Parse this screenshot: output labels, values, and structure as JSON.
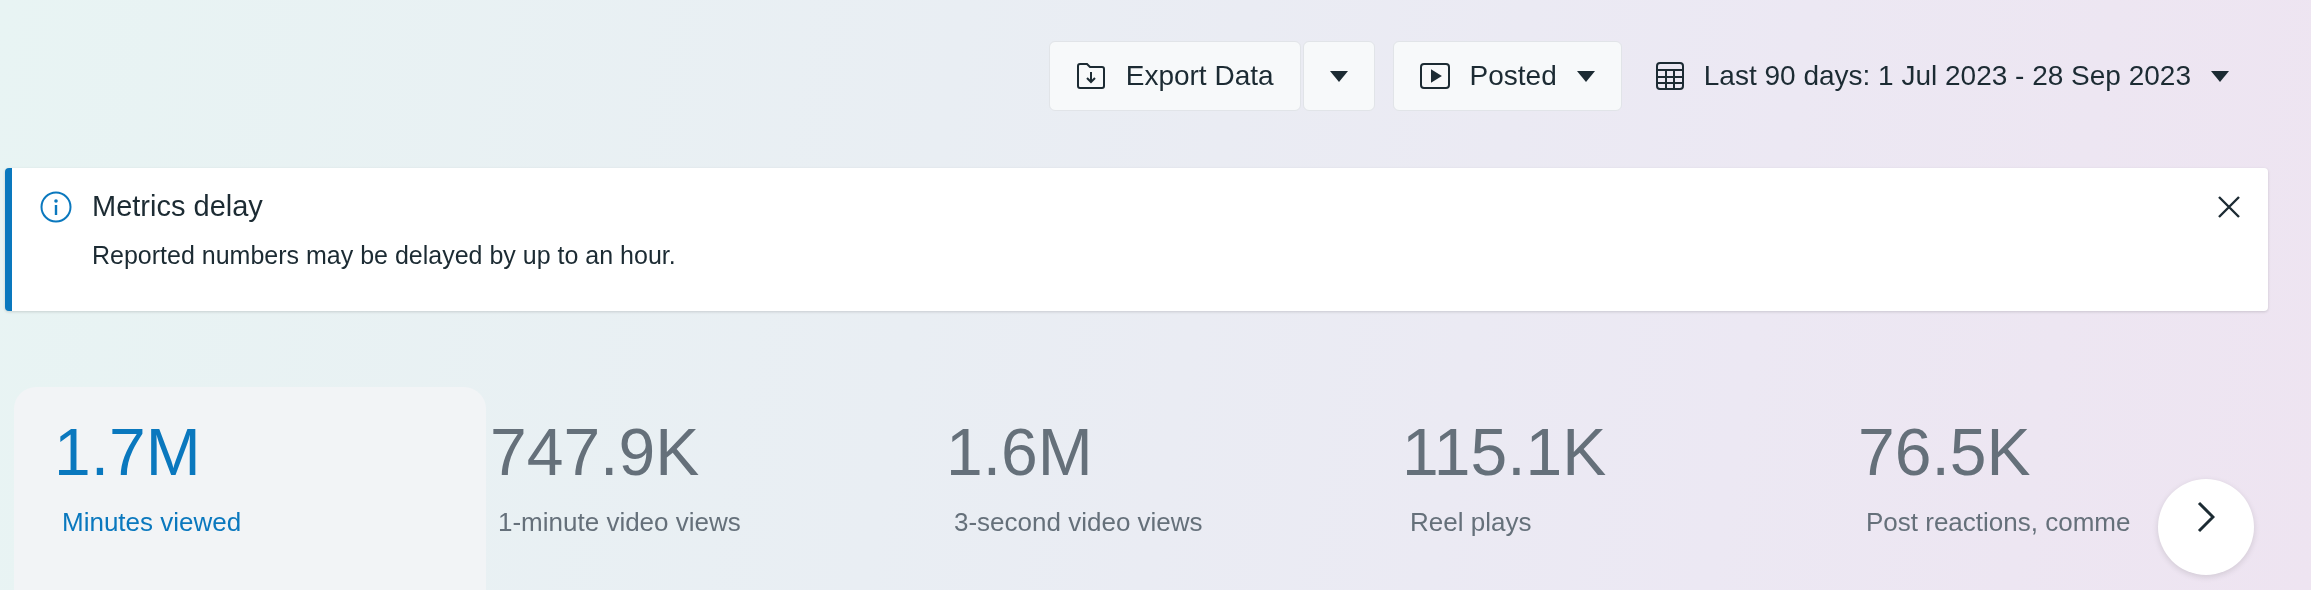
{
  "toolbar": {
    "export_button": {
      "label": "Export Data"
    },
    "status_filter": {
      "label": "Posted"
    },
    "date_range": {
      "label": "Last 90 days: 1 Jul 2023 - 28 Sep 2023"
    }
  },
  "notice": {
    "title": "Metrics delay",
    "message": "Reported numbers may be delayed by up to an hour."
  },
  "metrics": [
    {
      "value": "1.7M",
      "label": "Minutes viewed",
      "selected": true
    },
    {
      "value": "747.9K",
      "label": "1-minute video views",
      "selected": false
    },
    {
      "value": "1.6M",
      "label": "3-second video views",
      "selected": false
    },
    {
      "value": "115.1K",
      "label": "Reel plays",
      "selected": false
    },
    {
      "value": "76.5K",
      "label": "Post reactions, comme",
      "selected": false
    }
  ]
}
